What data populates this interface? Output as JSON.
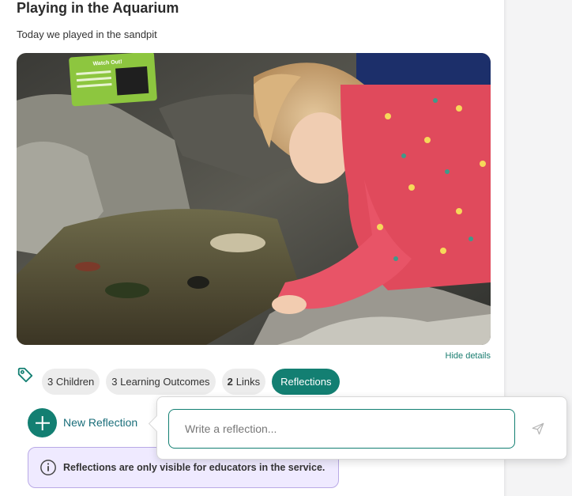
{
  "post": {
    "title": "Playing in the Aquarium",
    "subtitle": "Today we played in the sandpit",
    "photo_sign": {
      "heading": "Watch Out!"
    },
    "hide_details_label": "Hide details"
  },
  "tags": {
    "icon": "tag-icon",
    "chips": [
      {
        "count": "",
        "label": "3 Children",
        "active": false
      },
      {
        "count": "",
        "label": "3 Learning Outcomes",
        "active": false
      },
      {
        "count": "2",
        "label": "Links",
        "active": false
      },
      {
        "count": "",
        "label": "Reflections",
        "active": true
      }
    ]
  },
  "reflections": {
    "new_button_icon": "plus-icon",
    "new_label": "New Reflection",
    "input_placeholder": "Write a reflection...",
    "input_value": "",
    "send_icon": "send-icon",
    "info_icon": "info-icon",
    "info_text": "Reflections are only visible for educators in the service."
  },
  "colors": {
    "accent": "#137f72",
    "info_bg": "#efeaff",
    "info_border": "#b9a9e6"
  }
}
